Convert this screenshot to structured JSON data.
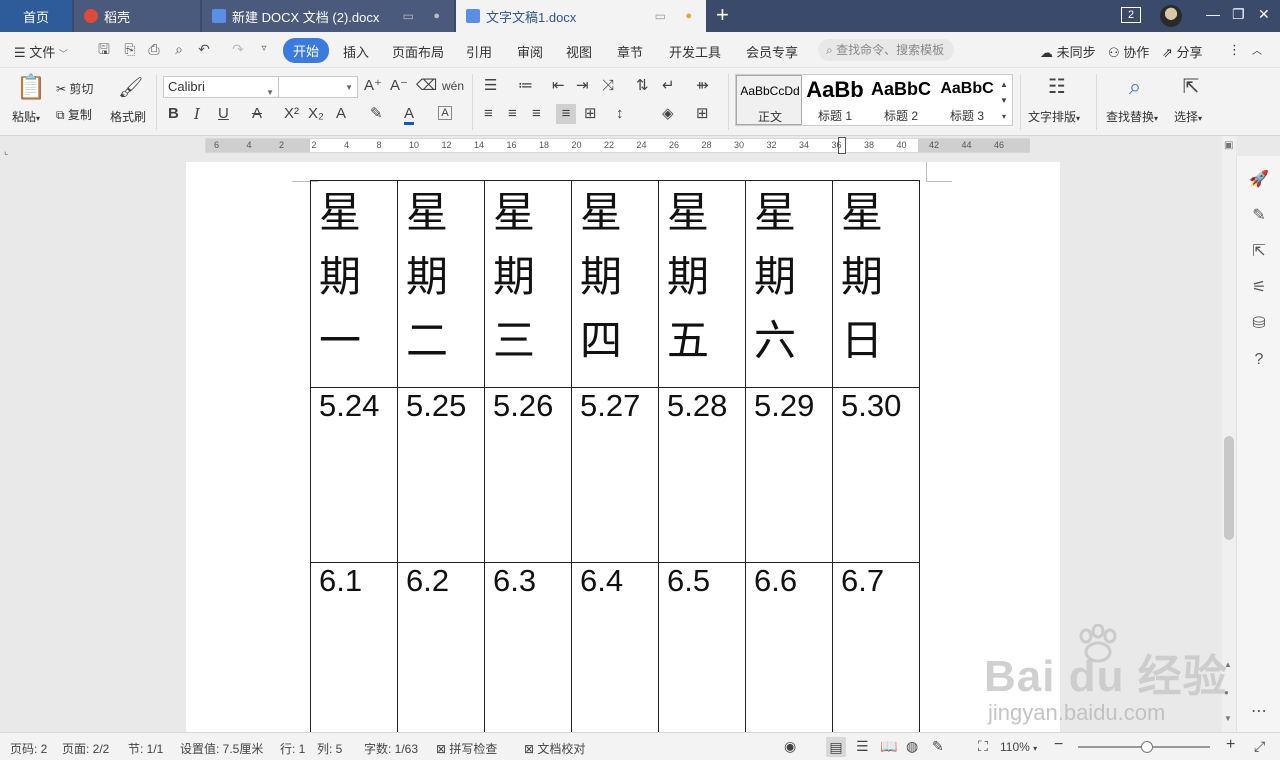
{
  "tabs": [
    {
      "label": "首页"
    },
    {
      "label": "稻壳"
    },
    {
      "label": "新建 DOCX 文档 (2).docx"
    },
    {
      "label": "文字文稿1.docx"
    }
  ],
  "window": {
    "count_badge": "2"
  },
  "menu": {
    "file": "文件",
    "items": [
      "开始",
      "插入",
      "页面布局",
      "引用",
      "审阅",
      "视图",
      "章节",
      "开发工具",
      "会员专享"
    ],
    "search_placeholder": "查找命令、搜索模板",
    "sync": "未同步",
    "collab": "协作",
    "share": "分享"
  },
  "ribbon": {
    "paste": "粘贴",
    "cut": "剪切",
    "copy": "复制",
    "format_painter": "格式刷",
    "font_name": "Calibri",
    "font_size": "",
    "styles": [
      {
        "sample": "AaBbCcDd",
        "name": "正文"
      },
      {
        "sample": "AaBb",
        "name": "标题 1"
      },
      {
        "sample": "AaBbC",
        "name": "标题 2"
      },
      {
        "sample": "AaBbC",
        "name": "标题 3"
      }
    ],
    "text_layout": "文字排版",
    "find_replace": "查找替换",
    "select": "选择"
  },
  "ruler": {
    "numbers": [
      "6",
      "4",
      "2",
      "2",
      "4",
      "8",
      "10",
      "12",
      "14",
      "16",
      "18",
      "20",
      "22",
      "24",
      "26",
      "28",
      "30",
      "32",
      "34",
      "36",
      "38",
      "40",
      "42",
      "44",
      "46"
    ]
  },
  "table": {
    "weekdays": [
      [
        "星",
        "期",
        "一"
      ],
      [
        "星",
        "期",
        "二"
      ],
      [
        "星",
        "期",
        "三"
      ],
      [
        "星",
        "期",
        "四"
      ],
      [
        "星",
        "期",
        "五"
      ],
      [
        "星",
        "期",
        "六"
      ],
      [
        "星",
        "期",
        "日"
      ]
    ],
    "row2": [
      "5.24",
      "5.25",
      "5.26",
      "5.27",
      "5.28",
      "5.29",
      "5.30"
    ],
    "row3": [
      "6.1",
      "6.2",
      "6.3",
      "6.4",
      "6.5",
      "6.6",
      "6.7"
    ]
  },
  "status": {
    "page_code": "页码: 2",
    "pages": "页面: 2/2",
    "section": "节: 1/1",
    "setting": "设置值: 7.5厘米",
    "row": "行: 1",
    "col": "列: 5",
    "words": "字数: 1/63",
    "spell": "拼写检查",
    "proof": "文档校对",
    "zoom": "110%"
  },
  "watermark": {
    "main": "Bai du 经验",
    "sub": "jingyan.baidu.com"
  }
}
